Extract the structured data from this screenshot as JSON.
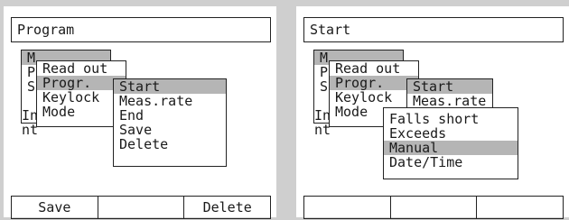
{
  "left_screen": {
    "title": "Program",
    "main_menu_partial": [
      "M",
      "P",
      "S"
    ],
    "instrument_partial": [
      "In",
      "nt"
    ],
    "submenu": [
      "Read out",
      "Progr.",
      "Keylock",
      "Mode"
    ],
    "submenu_selected_index": 1,
    "program_menu": [
      "Start",
      "Meas.rate",
      "End",
      "Save",
      "Delete"
    ],
    "program_selected_index": 0,
    "softkeys": [
      "Save",
      "",
      "Delete"
    ]
  },
  "right_screen": {
    "title": "Start",
    "main_menu_partial": [
      "M",
      "P",
      "S"
    ],
    "instrument_partial": [
      "In",
      "nt"
    ],
    "submenu": [
      "Read out",
      "Progr.",
      "Keylock",
      "Mode"
    ],
    "program_menu_partial": [
      "Start",
      "Meas.rate"
    ],
    "start_menu": [
      "Falls short",
      "Exceeds",
      "Manual",
      "Date/Time"
    ],
    "start_selected_index": 2,
    "softkeys": [
      "",
      "",
      ""
    ]
  }
}
